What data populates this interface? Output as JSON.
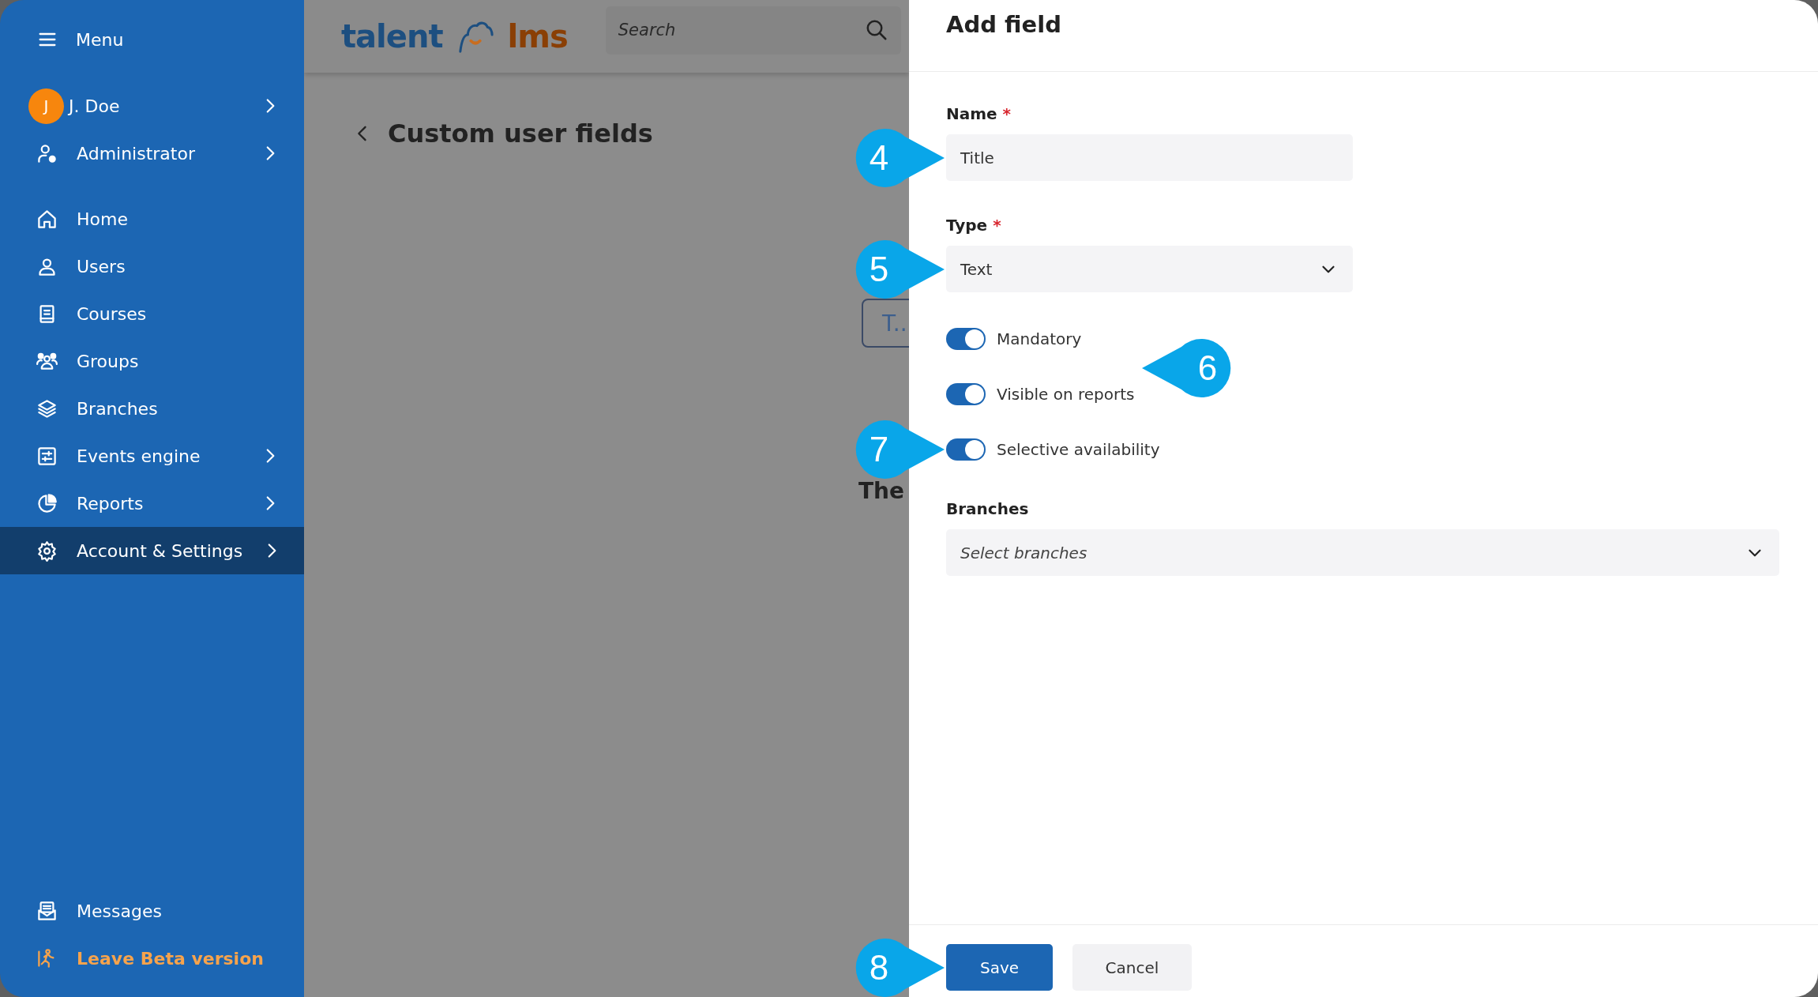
{
  "sidebar": {
    "menu_label": "Menu",
    "user": {
      "initial": "J",
      "name": "J. Doe"
    },
    "items": [
      {
        "label": "Administrator",
        "chevron": true,
        "selected": false
      },
      {
        "label": "Home",
        "chevron": false,
        "selected": false
      },
      {
        "label": "Users",
        "chevron": false,
        "selected": false
      },
      {
        "label": "Courses",
        "chevron": false,
        "selected": false
      },
      {
        "label": "Groups",
        "chevron": false,
        "selected": false
      },
      {
        "label": "Branches",
        "chevron": false,
        "selected": false
      },
      {
        "label": "Events engine",
        "chevron": true,
        "selected": false
      },
      {
        "label": "Reports",
        "chevron": true,
        "selected": false
      },
      {
        "label": "Account & Settings",
        "chevron": true,
        "selected": true
      }
    ],
    "bottom_items": [
      {
        "label": "Messages",
        "kind": "normal"
      },
      {
        "label": "Leave Beta version",
        "kind": "highlight"
      }
    ]
  },
  "header": {
    "logo": [
      "talent",
      "lms"
    ],
    "search": {
      "placeholder": "Search"
    }
  },
  "page": {
    "title": "Custom user fields",
    "card_text": "T..",
    "cut_text": "The"
  },
  "panel": {
    "title": "Add field",
    "fields": [
      {
        "label": "Name",
        "required_mark": "*",
        "kind": "text",
        "value": "Title",
        "callout": "4"
      },
      {
        "label": "Type",
        "required_mark": "*",
        "kind": "select",
        "value": "Text",
        "callout": "5"
      }
    ],
    "toggles_callout": "6",
    "toggles": [
      {
        "label": "Mandatory",
        "on": true
      },
      {
        "label": "Visible on reports",
        "on": true
      },
      {
        "label": "Selective availability",
        "on": true,
        "callout": "7"
      }
    ],
    "branches": {
      "label": "Branches",
      "placeholder": "Select branches"
    },
    "buttons": [
      {
        "label": "Save",
        "kind": "primary",
        "callout": "8"
      },
      {
        "label": "Cancel",
        "kind": "secondary"
      }
    ]
  }
}
